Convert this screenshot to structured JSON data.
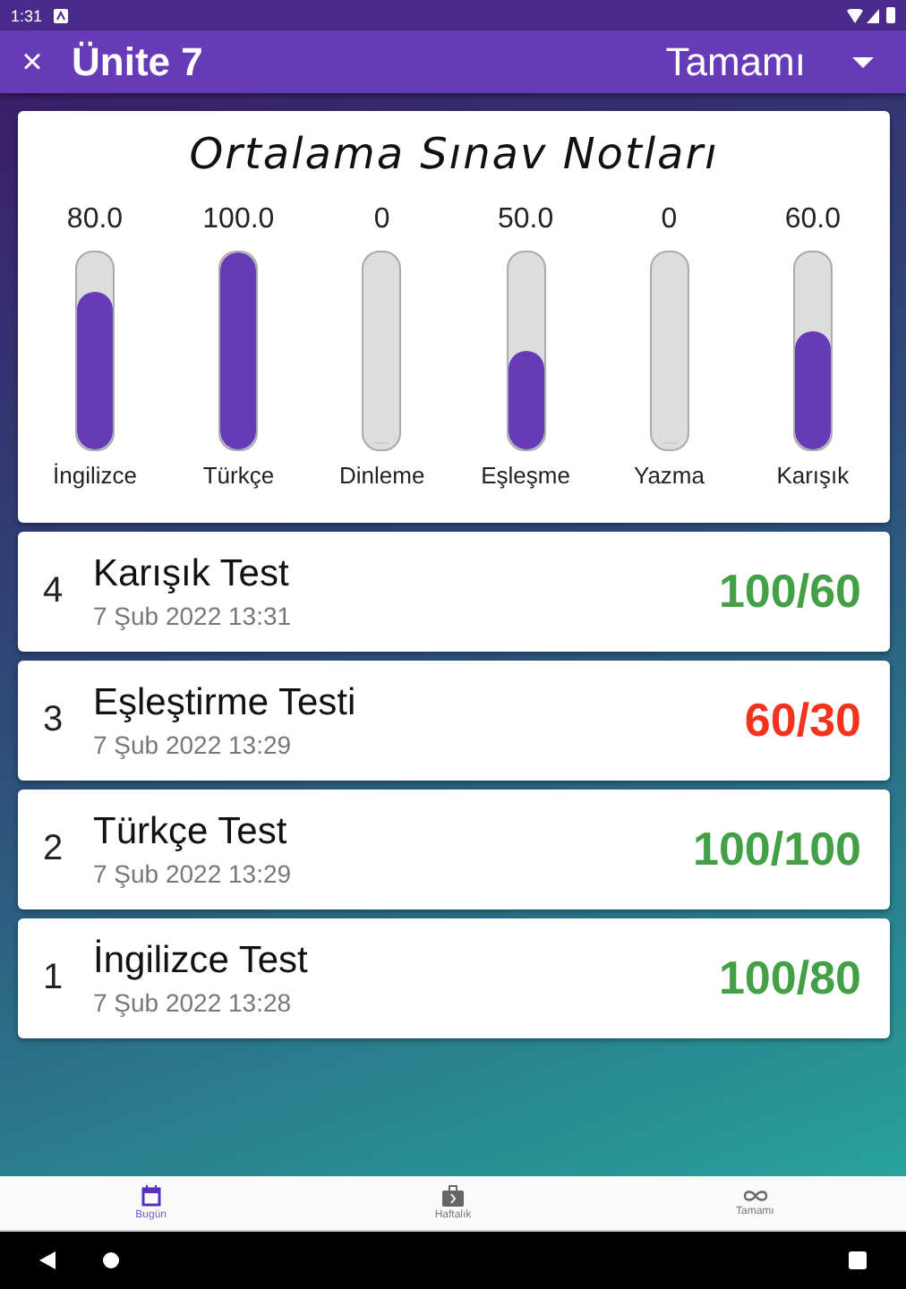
{
  "status_bar": {
    "time": "1:31"
  },
  "app_bar": {
    "title": "Ünite 7",
    "close_icon": "×",
    "filter": "Tamamı"
  },
  "averages": {
    "title": "Ortalama Sınav Notları",
    "bars": [
      {
        "label": "İngilizce",
        "value": "80.0",
        "level": 0.8
      },
      {
        "label": "Türkçe",
        "value": "100.0",
        "level": 1.0
      },
      {
        "label": "Dinleme",
        "value": "0",
        "level": 0
      },
      {
        "label": "Eşleşme",
        "value": "50.0",
        "level": 0.5
      },
      {
        "label": "Yazma",
        "value": "0",
        "level": 0
      },
      {
        "label": "Karışık",
        "value": "60.0",
        "level": 0.6
      }
    ]
  },
  "tests": [
    {
      "number": "4",
      "name": "Karışık Test",
      "date": "7 Şub 2022 13:31",
      "score": "100/60",
      "color": "#43a047"
    },
    {
      "number": "3",
      "name": "Eşleştirme Testi",
      "date": "7 Şub 2022 13:29",
      "score": "60/30",
      "color": "#f4321e"
    },
    {
      "number": "2",
      "name": "Türkçe Test",
      "date": "7 Şub 2022 13:29",
      "score": "100/100",
      "color": "#43a047"
    },
    {
      "number": "1",
      "name": "İngilizce Test",
      "date": "7 Şub 2022 13:28",
      "score": "100/80",
      "color": "#43a047"
    }
  ],
  "bottom_nav": [
    {
      "kind": "calendar",
      "label": "Bugün",
      "selected": true
    },
    {
      "kind": "briefcase",
      "label": "Haftalık",
      "selected": false
    },
    {
      "kind": "infinity",
      "label": "Tamamı",
      "selected": false
    }
  ]
}
